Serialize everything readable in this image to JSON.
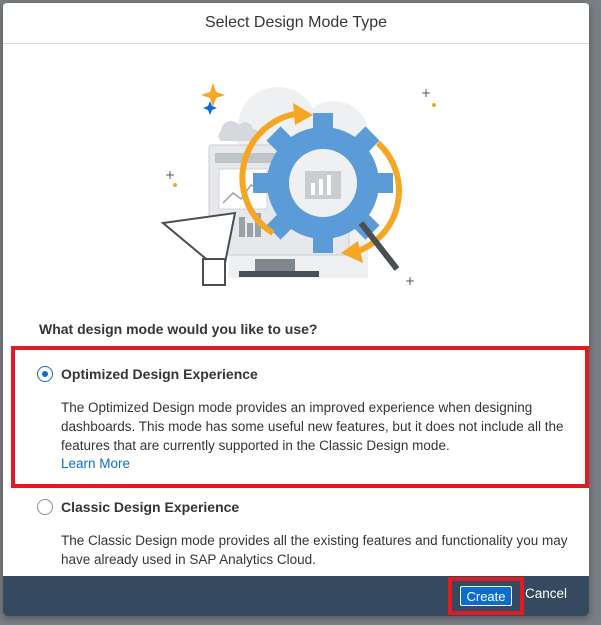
{
  "dialog": {
    "title": "Select Design Mode Type",
    "question": "What design mode would you like to use?"
  },
  "options": [
    {
      "title": "Optimized Design Experience",
      "description": "The Optimized Design mode provides an improved experience when designing dashboards. This mode has some useful new features, but it does not include all the features that are currently supported in the Classic Design mode.",
      "link": "Learn More",
      "selected": true
    },
    {
      "title": "Classic Design Experience",
      "description": "The Classic Design mode provides all the existing features and functionality you may have already used in SAP Analytics Cloud.",
      "selected": false
    }
  ],
  "footer": {
    "create_label": "Create",
    "cancel_label": "Cancel"
  },
  "colors": {
    "accent": "#0a6ed1",
    "footer": "#354a5f",
    "highlight": "#e01b24",
    "gear": "#5b9bd8",
    "orange": "#f5a623"
  }
}
